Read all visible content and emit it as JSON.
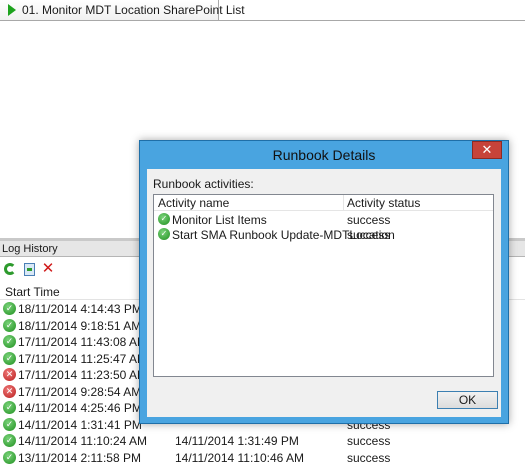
{
  "runbook_tab": {
    "label": "01. Monitor MDT Location SharePoint List"
  },
  "log_history": {
    "title": "Log History",
    "columns": {
      "start_time": "Start Time"
    },
    "rows": [
      {
        "status": "success",
        "start": "18/11/2014 4:14:43 PM",
        "end": "",
        "result": ""
      },
      {
        "status": "success",
        "start": "18/11/2014 9:18:51 AM",
        "end": "",
        "result": ""
      },
      {
        "status": "success",
        "start": "17/11/2014 11:43:08 AM",
        "end": "",
        "result": ""
      },
      {
        "status": "success",
        "start": "17/11/2014 11:25:47 AM",
        "end": "",
        "result": ""
      },
      {
        "status": "error",
        "start": "17/11/2014 11:23:50 AM",
        "end": "",
        "result": ""
      },
      {
        "status": "error",
        "start": "17/11/2014 9:28:54 AM",
        "end": "",
        "result": ""
      },
      {
        "status": "success",
        "start": "14/11/2014 4:25:46 PM",
        "end": "",
        "result": ""
      },
      {
        "status": "success",
        "start": "14/11/2014 1:31:41 PM",
        "end": "",
        "result": "success"
      },
      {
        "status": "success",
        "start": "14/11/2014 11:10:24 AM",
        "end": "14/11/2014 1:31:49 PM",
        "result": "success"
      },
      {
        "status": "success",
        "start": "13/11/2014 2:11:58 PM",
        "end": "14/11/2014 11:10:46 AM",
        "result": "success"
      }
    ]
  },
  "dialog": {
    "title": "Runbook Details",
    "close_label": "✕",
    "activities_label": "Runbook activities:",
    "columns": {
      "name": "Activity name",
      "status": "Activity status"
    },
    "activities": [
      {
        "name": "Monitor List Items",
        "status": "success"
      },
      {
        "name": "Start SMA Runbook Update-MDTLocation",
        "status": "success"
      }
    ],
    "ok_label": "OK"
  },
  "colors": {
    "title_bar": "#49a4e0",
    "success": "#1f8f1f",
    "error": "#b81c1c",
    "close": "#c7433a"
  },
  "icons": {
    "tab": "play-icon",
    "refresh": "refresh-icon",
    "export": "export-icon",
    "delete": "delete-icon",
    "success": "check-circle-icon",
    "error": "x-circle-icon"
  }
}
